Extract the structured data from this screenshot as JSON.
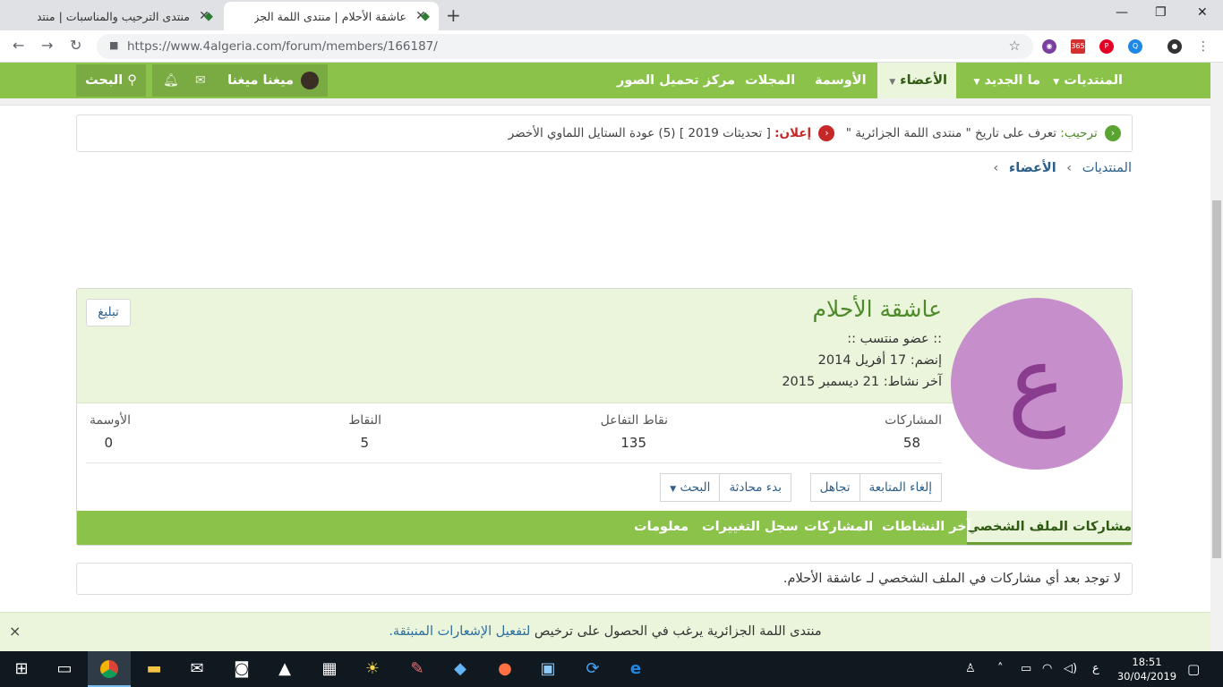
{
  "browser": {
    "tabs": [
      {
        "title": "منتدى الترحيب والمناسبات | منتدى"
      },
      {
        "title": "عاشقة الأحلام | منتدى اللمة الجزائرية"
      }
    ],
    "new_tab": "+",
    "url": "https://www.4algeria.com/forum/members/166187/",
    "window_controls": {
      "minimize": "—",
      "maximize": "❐",
      "close": "✕"
    }
  },
  "nav": {
    "forums": "المنتديات",
    "whats_new": "ما الجديد",
    "members": "الأعضاء",
    "medals": "الأوسمة",
    "magazines": "المجلات",
    "image_upload": "مركز تحميل الصور",
    "user": "ميغنا ميغنا",
    "search": "البحث"
  },
  "notice": {
    "lead": "ترحيب:",
    "welcome_text": "تعرف على تاريخ \" منتدى اللمة الجزائرية \"",
    "announce_label": "إعلان:",
    "announce_text": "[ تحديثات 2019 ] (5) عودة الستايل اللماوي الأخضر"
  },
  "breadcrumb": {
    "forums": "المنتديات",
    "members": "الأعضاء"
  },
  "profile": {
    "avatar_letter": "ع",
    "username": "عاشقة الأحلام",
    "title": ":: عضو منتسب ::",
    "joined": "إنضم: 17 أفريل 2014",
    "last_seen": "آخر نشاط: 21 ديسمبر 2015",
    "report": "تبليغ",
    "stats": [
      {
        "label": "المشاركات",
        "value": "58"
      },
      {
        "label": "نقاط التفاعل",
        "value": "135"
      },
      {
        "label": "النقاط",
        "value": "5"
      },
      {
        "label": "الأوسمة",
        "value": "0"
      }
    ],
    "buttons": {
      "unfollow": "إلغاء المتابعة",
      "ignore": "تجاهل",
      "start_conversation": "بدء محادثة",
      "search": "البحث"
    },
    "tabs": {
      "profile_posts": "مشاركات الملف الشخصي",
      "latest_activity": "آخر النشاطات",
      "postings": "المشاركات",
      "changes": "سجل التغييرات",
      "about": "معلومات"
    }
  },
  "empty_message": "لا توجد بعد أي مشاركات في الملف الشخصي لـ عاشقة الأحلام.",
  "push": {
    "text": "منتدى اللمة الجزائرية يرغب في الحصول على ترخيص",
    "link": "لتفعيل الإشعارات المنبثقة.",
    "close": "×"
  },
  "taskbar": {
    "keyboard": "ع",
    "time": "18:51",
    "date": "30/04/2019"
  },
  "colors": {
    "forum_green": "#8bc34a",
    "light_green": "#eaf5dc",
    "avatar_bg": "#c68fcb",
    "link_blue": "#2c5f8a"
  }
}
